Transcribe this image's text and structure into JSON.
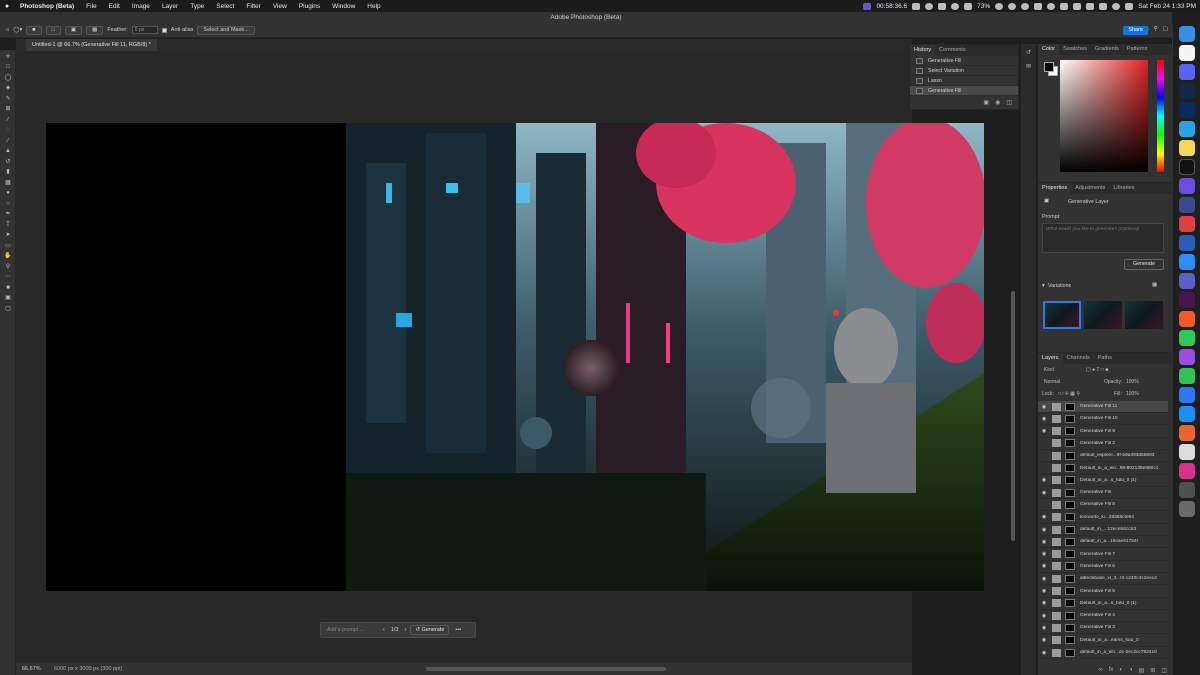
{
  "menubar": {
    "app_name": "Photoshop (Beta)",
    "items": [
      "File",
      "Edit",
      "Image",
      "Layer",
      "Type",
      "Select",
      "Filter",
      "View",
      "Plugins",
      "Window",
      "Help"
    ],
    "timer": "00:58:36.6",
    "battery": "73%",
    "clock": "Sat Feb 24  1:33 PM"
  },
  "window": {
    "title": "Adobe Photoshop (Beta)"
  },
  "optionsbar": {
    "feather_label": "Feather:",
    "feather_value": "0 px",
    "antialias_label": "Anti-alias",
    "select_mask_label": "Select and Mask...",
    "share_label": "Share"
  },
  "document": {
    "tab_title": "Untitled-1 @ 66.7% (Generative Fill 11, RGB/8) *"
  },
  "contextbar": {
    "prompt_placeholder": "Add a prompt ...",
    "page": "1/3",
    "generate_label": "Generate",
    "more_label": "•••"
  },
  "statusbar": {
    "zoom": "66.67%",
    "doc_info": "6000 px x 3000 px (300 ppi)"
  },
  "history": {
    "tabs": [
      "History",
      "Comments"
    ],
    "items": [
      "Generative Fill",
      "Select Variation",
      "Lasso",
      "Generative Fill"
    ],
    "selected_index": 3
  },
  "color": {
    "tabs": [
      "Color",
      "Swatches",
      "Gradients",
      "Patterns"
    ]
  },
  "properties": {
    "tabs": [
      "Properties",
      "Adjustments",
      "Libraries"
    ],
    "layer_type": "Generative Layer",
    "prompt_label": "Prompt:",
    "prompt_placeholder": "What would you like to generate? (Optional)",
    "generate_label": "Generate",
    "variations_label": "Variations"
  },
  "layers": {
    "tabs": [
      "Layers",
      "Channels",
      "Paths"
    ],
    "filter_kind": "Kind",
    "blend_mode": "Normal",
    "opacity_label": "Opacity:",
    "opacity_value": "100%",
    "lock_label": "Lock:",
    "fill_label": "Fill:",
    "fill_value": "100%",
    "items": [
      "Generative Fill 11",
      "Generative Fill 10",
      "Generative Fill 9",
      "Generative Fill 2",
      "default_explore...8f-b9a393d59893",
      "Default_in_a_wo...98-802135e580c1",
      "Default_in_a...s_futu_0 (1)",
      "Generative Fill",
      "Generative Fill 8",
      "leonardo_ki...39368cfe94",
      "default_in_...12eceb6ccb3",
      "default_in_a...19cae81784f",
      "Generative Fill 7",
      "Generative Fill 6",
      "albedobase_xl_3...f4-c240c4c2eec4",
      "Generative Fill 5",
      "Default_in_a...s_futu_0 (1)",
      "Generative Fill 4",
      "Generative Fill 3",
      "Default_in_a...eams_futu_0",
      "default_in_a_wo...dc-bec2cc782410"
    ]
  }
}
